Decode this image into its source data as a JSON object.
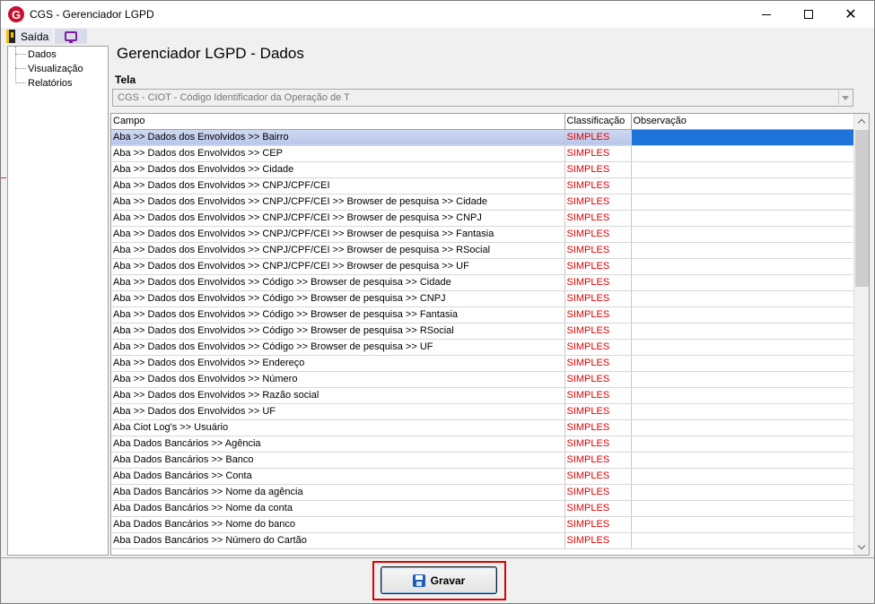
{
  "window": {
    "logo_letter": "G",
    "title": "CGS - Gerenciador LGPD"
  },
  "menubar": {
    "exit_label": "Saída"
  },
  "tree": {
    "items": [
      "Dados",
      "Visualização",
      "Relatórios"
    ]
  },
  "main": {
    "heading": "Gerenciador LGPD - Dados",
    "tela_label": "Tela",
    "tela_value": "CGS - CIOT - Código Identificador da Operação de T"
  },
  "grid": {
    "columns": [
      "Campo",
      "Classificação",
      "Observação"
    ],
    "selected_row": 0,
    "rows": [
      {
        "campo": "Aba >> Dados dos Envolvidos >> Bairro",
        "classificacao": "SIMPLES",
        "observacao": ""
      },
      {
        "campo": "Aba >> Dados dos Envolvidos >> CEP",
        "classificacao": "SIMPLES",
        "observacao": ""
      },
      {
        "campo": "Aba >> Dados dos Envolvidos >> Cidade",
        "classificacao": "SIMPLES",
        "observacao": ""
      },
      {
        "campo": "Aba >> Dados dos Envolvidos >> CNPJ/CPF/CEI",
        "classificacao": "SIMPLES",
        "observacao": ""
      },
      {
        "campo": "Aba >> Dados dos Envolvidos >> CNPJ/CPF/CEI >> Browser de pesquisa >> Cidade",
        "classificacao": "SIMPLES",
        "observacao": ""
      },
      {
        "campo": "Aba >> Dados dos Envolvidos >> CNPJ/CPF/CEI >> Browser de pesquisa >> CNPJ",
        "classificacao": "SIMPLES",
        "observacao": ""
      },
      {
        "campo": "Aba >> Dados dos Envolvidos >> CNPJ/CPF/CEI >> Browser de pesquisa >> Fantasia",
        "classificacao": "SIMPLES",
        "observacao": ""
      },
      {
        "campo": "Aba >> Dados dos Envolvidos >> CNPJ/CPF/CEI >> Browser de pesquisa >> RSocial",
        "classificacao": "SIMPLES",
        "observacao": ""
      },
      {
        "campo": "Aba >> Dados dos Envolvidos >> CNPJ/CPF/CEI >> Browser de pesquisa >> UF",
        "classificacao": "SIMPLES",
        "observacao": ""
      },
      {
        "campo": "Aba >> Dados dos Envolvidos >> Código >> Browser de pesquisa >> Cidade",
        "classificacao": "SIMPLES",
        "observacao": ""
      },
      {
        "campo": "Aba >> Dados dos Envolvidos >> Código >> Browser de pesquisa >> CNPJ",
        "classificacao": "SIMPLES",
        "observacao": ""
      },
      {
        "campo": "Aba >> Dados dos Envolvidos >> Código >> Browser de pesquisa >> Fantasia",
        "classificacao": "SIMPLES",
        "observacao": ""
      },
      {
        "campo": "Aba >> Dados dos Envolvidos >> Código >> Browser de pesquisa >> RSocial",
        "classificacao": "SIMPLES",
        "observacao": ""
      },
      {
        "campo": "Aba >> Dados dos Envolvidos >> Código >> Browser de pesquisa >> UF",
        "classificacao": "SIMPLES",
        "observacao": ""
      },
      {
        "campo": "Aba >> Dados dos Envolvidos >> Endereço",
        "classificacao": "SIMPLES",
        "observacao": ""
      },
      {
        "campo": "Aba >> Dados dos Envolvidos >> Número",
        "classificacao": "SIMPLES",
        "observacao": ""
      },
      {
        "campo": "Aba >> Dados dos Envolvidos >> Razão social",
        "classificacao": "SIMPLES",
        "observacao": ""
      },
      {
        "campo": "Aba >> Dados dos Envolvidos >> UF",
        "classificacao": "SIMPLES",
        "observacao": ""
      },
      {
        "campo": "Aba Ciot Log's >> Usuário",
        "classificacao": "SIMPLES",
        "observacao": ""
      },
      {
        "campo": "Aba Dados Bancários >> Agência",
        "classificacao": "SIMPLES",
        "observacao": ""
      },
      {
        "campo": "Aba Dados Bancários >> Banco",
        "classificacao": "SIMPLES",
        "observacao": ""
      },
      {
        "campo": "Aba Dados Bancários >> Conta",
        "classificacao": "SIMPLES",
        "observacao": ""
      },
      {
        "campo": "Aba Dados Bancários >> Nome da agência",
        "classificacao": "SIMPLES",
        "observacao": ""
      },
      {
        "campo": "Aba Dados Bancários >> Nome da conta",
        "classificacao": "SIMPLES",
        "observacao": ""
      },
      {
        "campo": "Aba Dados Bancários >> Nome do banco",
        "classificacao": "SIMPLES",
        "observacao": ""
      },
      {
        "campo": "Aba Dados Bancários >> Número do Cartão",
        "classificacao": "SIMPLES",
        "observacao": ""
      }
    ]
  },
  "footer": {
    "save_label": "Gravar"
  }
}
